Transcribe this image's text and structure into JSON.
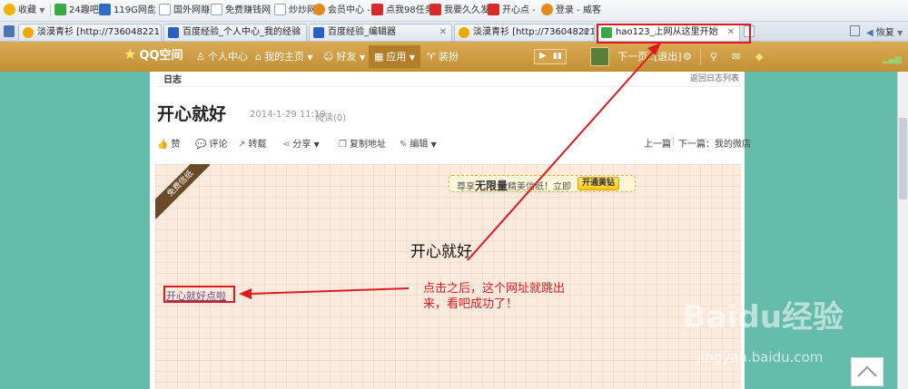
{
  "favorites": [
    {
      "label": "收藏",
      "color": "#f0b400"
    },
    {
      "label": "24趣吧",
      "color": "#3aa843"
    },
    {
      "label": "119G网盘",
      "color": "#2f6cc4"
    },
    {
      "label": "国外网赚",
      "color": "#6a8fbd"
    },
    {
      "label": "免费赚钱网",
      "color": "#6a8fbd"
    },
    {
      "label": "炒炒网",
      "color": "#6a8fbd"
    },
    {
      "label": "会员中心 -",
      "color": "#e38a1e"
    },
    {
      "label": "点我98任务",
      "color": "#d72a2a"
    },
    {
      "label": "我要久久发",
      "color": "#d72a2a"
    },
    {
      "label": "开心点 -",
      "color": "#d72a2a"
    },
    {
      "label": "登录 - 威客",
      "color": "#e38a1e"
    }
  ],
  "tabs": [
    {
      "label": "淡漠青衫 [http://736048221....",
      "color": "#f2a800"
    },
    {
      "label": "百度经验_个人中心_我的经验",
      "color": "#2a5fc4"
    },
    {
      "label": "百度经验_编辑器",
      "color": "#2a5fc4"
    },
    {
      "label": "淡漠青衫 [http://736048221....",
      "color": "#f2a800"
    },
    {
      "label": "hao123_上网从这里开始",
      "color": "#3aa843"
    }
  ],
  "browser": {
    "restore_label": "恢复"
  },
  "qzone": {
    "logo": "QQ空间",
    "items": [
      "个人中心",
      "我的主页",
      "好友",
      "应用",
      "装扮"
    ],
    "next_page": "下一页...",
    "logout": "[退出]"
  },
  "blog": {
    "section": "日志",
    "back_link": "返回日志列表",
    "title": "开心就好",
    "date": "2014-1-29 11:19",
    "read_count": "阅读(0)",
    "toolbar": [
      "赞",
      "评论",
      "转载",
      "分享",
      "复制地址",
      "编辑"
    ],
    "prev_label": "上一篇",
    "next_label": "下一篇：我的微店",
    "corner_ribbon": "免费信纸",
    "promo_prefix": "尊享",
    "promo_strong": "无限量",
    "promo_suffix": "精美信纸！立即",
    "promo_button": "开通黄钻",
    "letter_title": "开心就好",
    "link_text": "开心就好点啦"
  },
  "annotation": {
    "text": "点击之后，这个网址就跳出来，看吧成功了！",
    "color": "#e0191e"
  },
  "watermark": {
    "brand": "Baidu经验",
    "url": "jingyan.baidu.com"
  }
}
